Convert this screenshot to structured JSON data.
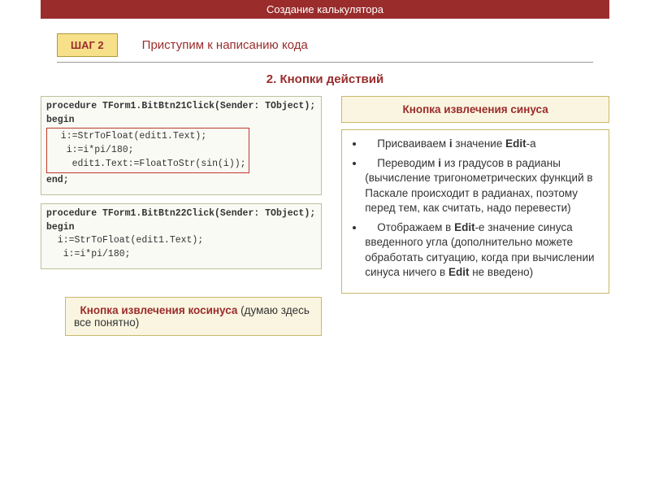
{
  "header": "Создание калькулятора",
  "step": {
    "badge": "ШАГ 2",
    "text": "Приступим к написанию кода"
  },
  "section_title": "2.  Кнопки действий",
  "code1": {
    "l1": "procedure TForm1.BitBtn21Click(Sender: TObject);",
    "l2": "begin",
    "l3": "  i:=StrToFloat(edit1.Text);",
    "l4": "   i:=i*pi/180;",
    "l5": "    edit1.Text:=FloatToStr(sin(i));",
    "l6": "end;"
  },
  "code2": {
    "l1": "procedure TForm1.BitBtn22Click(Sender: TObject);",
    "l2": "begin",
    "l3": "  i:=StrToFloat(edit1.Text);",
    "l4": "   i:=i*pi/180;"
  },
  "sin_callout": "Кнопка извлечения синуса",
  "cos_callout": {
    "lead": "Кнопка извлечения косинуса",
    "rest": " (думаю здесь все понятно)"
  },
  "notes": {
    "li1a": "Присваиваем ",
    "li1b": "i",
    "li1c": " значение ",
    "li1d": "Edit",
    "li1e": "-а",
    "li2a": "Переводим ",
    "li2b": "i",
    "li2c": " из градусов в радианы (вычисление тригонометрических функций в Паскале происходит в радианах, поэтому перед тем, как считать, надо перевести)",
    "li3a": "Отображаем в ",
    "li3b": "Edit",
    "li3c": "-е значение синуса введенного угла (дополнительно можете обработать ситуацию, когда при вычислении синуса ничего в ",
    "li3d": "Edit",
    "li3e": " не введено)"
  }
}
